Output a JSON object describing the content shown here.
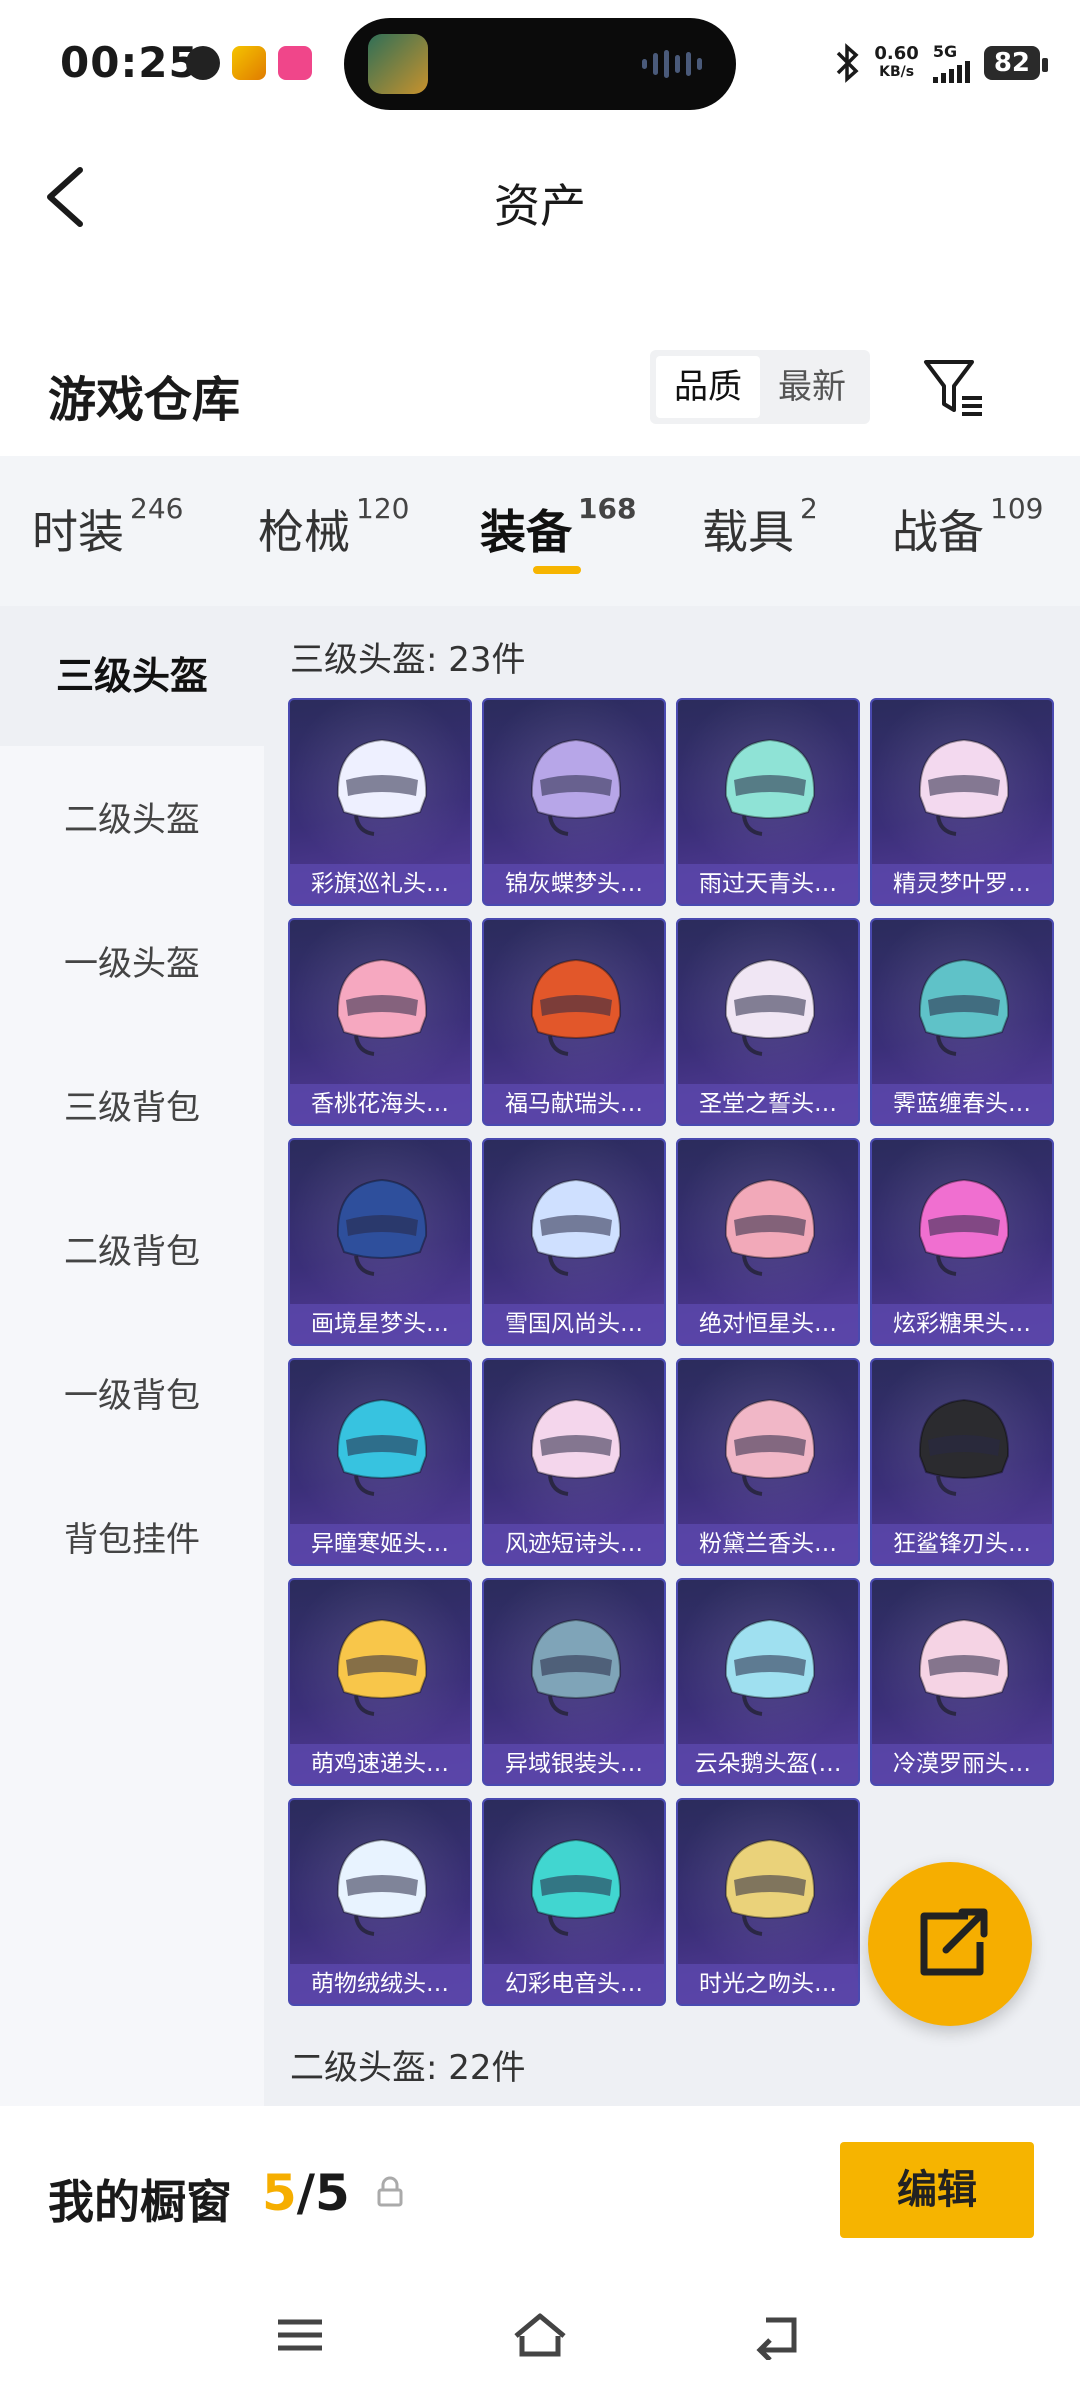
{
  "status_bar": {
    "time": "00:25",
    "network_speed_value": "0.60",
    "network_speed_unit": "KB/s",
    "network_type": "5G",
    "battery": "82"
  },
  "nav": {
    "title": "资产"
  },
  "warehouse": {
    "title": "游戏仓库",
    "sort_options": [
      "品质",
      "最新"
    ],
    "sort_selected": "品质"
  },
  "tabs": [
    {
      "label": "时装",
      "count": "246"
    },
    {
      "label": "枪械",
      "count": "120"
    },
    {
      "label": "装备",
      "count": "168"
    },
    {
      "label": "载具",
      "count": "2"
    },
    {
      "label": "战备",
      "count": "109"
    }
  ],
  "active_tab": "装备",
  "sidebar": {
    "items": [
      "三级头盔",
      "二级头盔",
      "一级头盔",
      "三级背包",
      "二级背包",
      "一级背包",
      "背包挂件"
    ],
    "active": "三级头盔"
  },
  "groups": {
    "level3_label": "三级头盔: 23件",
    "level2_label": "二级头盔: 22件"
  },
  "items": [
    {
      "name": "彩旗巡礼头…",
      "color": "#eef0ff"
    },
    {
      "name": "锦灰蝶梦头…",
      "color": "#b7a6e8"
    },
    {
      "name": "雨过天青头…",
      "color": "#8fe3d6"
    },
    {
      "name": "精灵梦叶罗…",
      "color": "#f3d9ef"
    },
    {
      "name": "香桃花海头…",
      "color": "#f6a8c0"
    },
    {
      "name": "福马献瑞头…",
      "color": "#e2572a"
    },
    {
      "name": "圣堂之誓头…",
      "color": "#f0e6f4"
    },
    {
      "name": "霁蓝缠春头…",
      "color": "#5fc2c8"
    },
    {
      "name": "画境星梦头…",
      "color": "#2e4f9c"
    },
    {
      "name": "雪国风尚头…",
      "color": "#cfe0ff"
    },
    {
      "name": "绝对恒星头…",
      "color": "#f2a9b9"
    },
    {
      "name": "炫彩糖果头…",
      "color": "#f06fd0"
    },
    {
      "name": "异瞳寒姬头…",
      "color": "#37c3e0"
    },
    {
      "name": "风迹短诗头…",
      "color": "#f4d6ec"
    },
    {
      "name": "粉黛兰香头…",
      "color": "#f1b7c7"
    },
    {
      "name": "狂鲨锋刃头…",
      "color": "#2b2b2f"
    },
    {
      "name": "萌鸡速递头…",
      "color": "#f8c64a"
    },
    {
      "name": "异域银装头…",
      "color": "#7fa4b8"
    },
    {
      "name": "云朵鹅头盔(…",
      "color": "#9fe0f0"
    },
    {
      "name": "冷漠罗丽头…",
      "color": "#f5d3e4"
    },
    {
      "name": "萌物绒绒头…",
      "color": "#e8f3ff"
    },
    {
      "name": "幻彩电音头…",
      "color": "#41d6d0"
    },
    {
      "name": "时光之吻头…",
      "color": "#ead27a"
    }
  ],
  "footer": {
    "showcase_title": "我的橱窗",
    "showcase_current": "5",
    "showcase_total": "/5",
    "edit_label": "编辑"
  },
  "theme": {
    "accent": "#f6b400",
    "card_bg": "#3b2f79"
  }
}
